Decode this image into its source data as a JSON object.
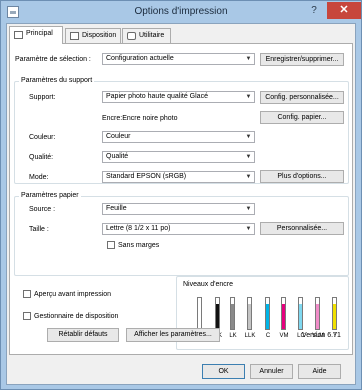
{
  "window": {
    "title": "Options d'impression"
  },
  "tabs": [
    {
      "label": "Principal"
    },
    {
      "label": "Disposition"
    },
    {
      "label": "Utilitaire"
    }
  ],
  "main": {
    "selection_label": "Paramètre de sélection :",
    "selection_value": "Configuration actuelle",
    "save_delete_button": "Enregistrer/supprimer...",
    "media_group_title": "Paramètres du support",
    "support_label": "Support:",
    "support_value": "Papier photo haute qualité Glacé",
    "custom_config_button": "Config. personnalisée...",
    "ink_note": "Encre:Encre noire photo",
    "paper_config_button": "Config. papier...",
    "color_label": "Couleur:",
    "color_value": "Couleur",
    "quality_label": "Qualité:",
    "quality_value": "Qualité",
    "mode_label": "Mode:",
    "mode_value": "Standard EPSON (sRGB)",
    "more_options_button": "Plus d'options...",
    "paper_group_title": "Paramètres papier",
    "source_label": "Source :",
    "source_value": "Feuille",
    "size_label": "Taille :",
    "size_value": "Lettre (8 1/2 x 11 po)",
    "customize_button": "Personnalisée...",
    "borderless_label": "Sans marges",
    "preview_label": "Aperçu avant impression",
    "layout_manager_label": "Gestionnaire de disposition"
  },
  "ink": {
    "title": "Niveaux d'encre",
    "items": [
      {
        "label": "MK",
        "color": "#c8c8c8",
        "level": 0
      },
      {
        "label": "PK",
        "color": "#111111",
        "level": 0.8
      },
      {
        "label": "LK",
        "color": "#8a8a8a",
        "level": 0.8
      },
      {
        "label": "LLK",
        "color": "#c4c4c4",
        "level": 0.8
      },
      {
        "label": "C",
        "color": "#00b4e6",
        "level": 0.8
      },
      {
        "label": "VM",
        "color": "#e6007e",
        "level": 0.8
      },
      {
        "label": "LC",
        "color": "#7fd8f0",
        "level": 0.8
      },
      {
        "label": "VLM",
        "color": "#f08cc8",
        "level": 0.8
      },
      {
        "label": "Y",
        "color": "#f0e000",
        "level": 0.8
      }
    ]
  },
  "footer": {
    "reset_button": "Rétablir défauts",
    "show_settings_button": "Afficher les paramètres...",
    "version": "Version 6.71",
    "ok_button": "OK",
    "cancel_button": "Annuler",
    "help_button": "Aide"
  }
}
